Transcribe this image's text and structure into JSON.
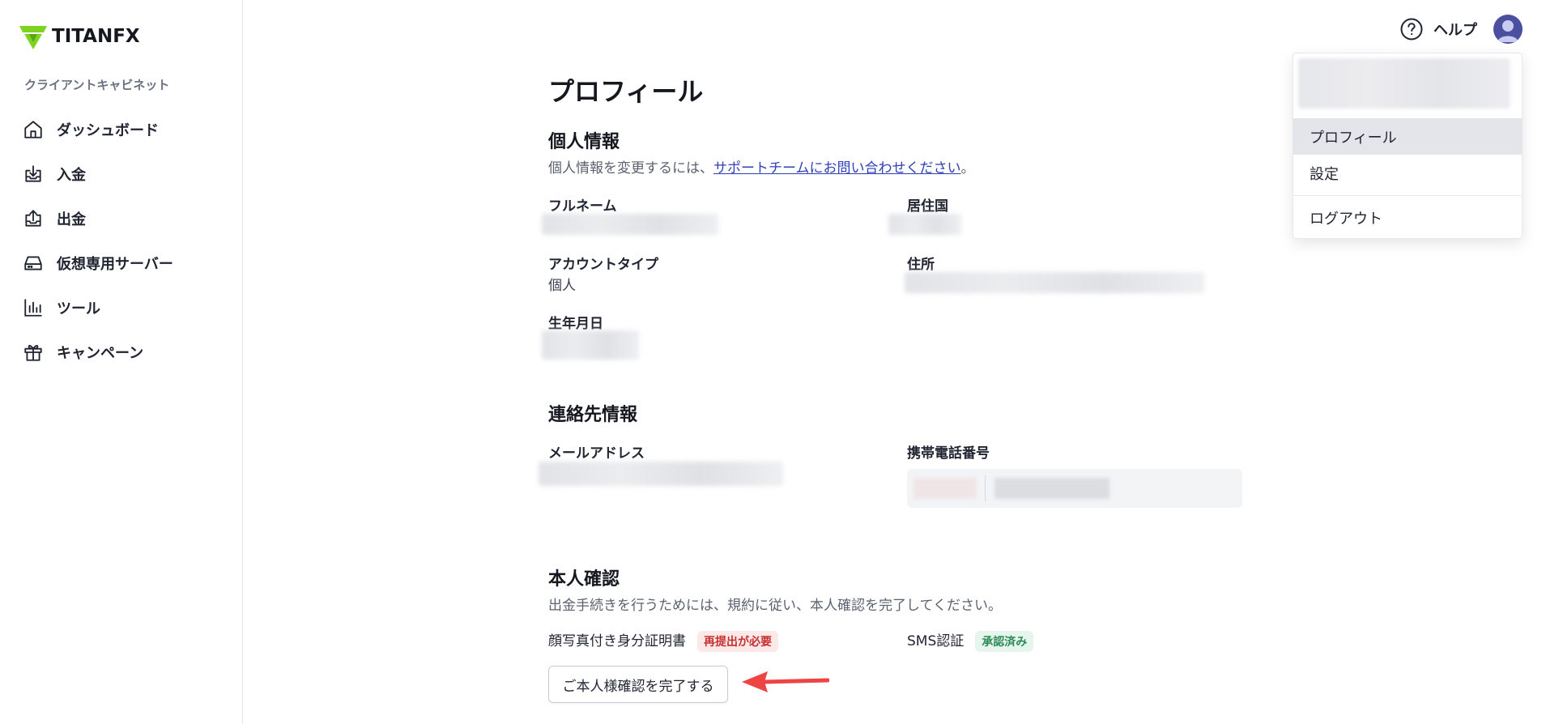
{
  "brand": {
    "logo_text": "TITANFX",
    "accent": "#7ed321"
  },
  "sidebar": {
    "heading": "クライアントキャビネット",
    "items": [
      {
        "label": "ダッシュボード",
        "icon": "home-icon"
      },
      {
        "label": "入金",
        "icon": "deposit-icon"
      },
      {
        "label": "出金",
        "icon": "withdraw-icon"
      },
      {
        "label": "仮想専用サーバー",
        "icon": "server-icon"
      },
      {
        "label": "ツール",
        "icon": "chart-icon"
      },
      {
        "label": "キャンペーン",
        "icon": "gift-icon"
      }
    ]
  },
  "header": {
    "help_label": "ヘルプ"
  },
  "user_menu": {
    "items": [
      {
        "label": "プロフィール",
        "active": true
      },
      {
        "label": "設定"
      },
      {
        "label": "ログアウト"
      }
    ]
  },
  "page": {
    "title": "プロフィール",
    "personal": {
      "title": "個人情報",
      "desc_prefix": "個人情報を変更するには、",
      "desc_link": "サポートチームにお問い合わせください",
      "desc_suffix": "。",
      "fields": {
        "full_name_label": "フルネーム",
        "country_label": "居住国",
        "account_type_label": "アカウントタイプ",
        "account_type_value": "個人",
        "address_label": "住所",
        "dob_label": "生年月日"
      }
    },
    "contact": {
      "title": "連絡先情報",
      "email_label": "メールアドレス",
      "phone_label": "携帯電話番号"
    },
    "verification": {
      "title": "本人確認",
      "desc": "出金手続きを行うためには、規約に従い、本人確認を完了してください。",
      "id_doc_label": "顔写真付き身分証明書",
      "id_doc_status": "再提出が必要",
      "sms_label": "SMS認証",
      "sms_status": "承認済み",
      "cta_label": "ご本人様確認を完了する"
    }
  }
}
